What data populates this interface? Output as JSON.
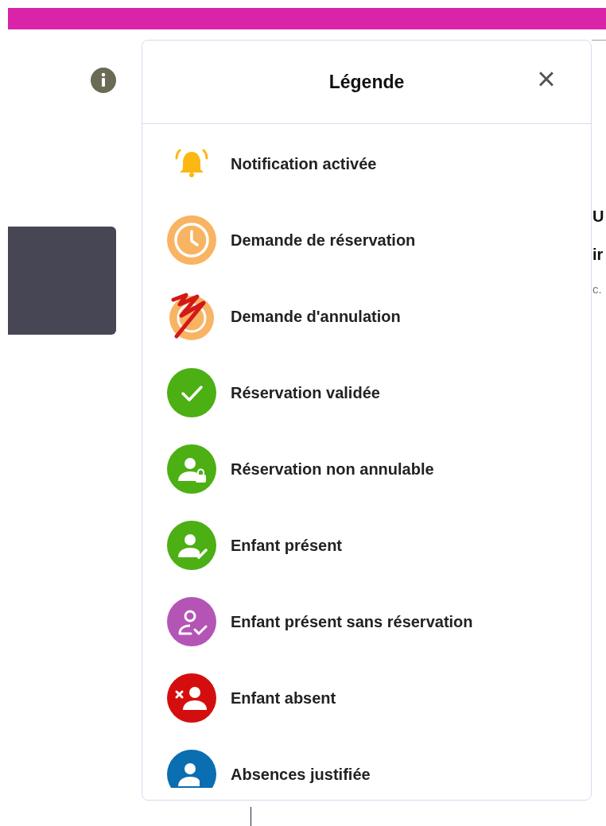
{
  "legend": {
    "title": "Légende",
    "close": "×",
    "items": [
      {
        "kind": "bell",
        "color": "#fbb813",
        "label": "Notification activée"
      },
      {
        "kind": "clock",
        "color": "#f8b462",
        "label": "Demande de réservation"
      },
      {
        "kind": "cancel",
        "color": "#f8b462",
        "label": "Demande d'annulation"
      },
      {
        "kind": "check",
        "color": "#4caf14",
        "label": "Réservation validée"
      },
      {
        "kind": "lock",
        "color": "#4caf14",
        "label": "Réservation non annulable"
      },
      {
        "kind": "present",
        "color": "#4caf14",
        "label": "Enfant présent"
      },
      {
        "kind": "present-outline",
        "color": "#b455b6",
        "label": "Enfant présent sans réservation"
      },
      {
        "kind": "absent",
        "color": "#d40e0e",
        "label": "Enfant absent"
      },
      {
        "kind": "person",
        "color": "#0a6eb0",
        "label": "Absences justifiée"
      }
    ]
  },
  "background_texts": [
    "U",
    "ir",
    "c."
  ]
}
